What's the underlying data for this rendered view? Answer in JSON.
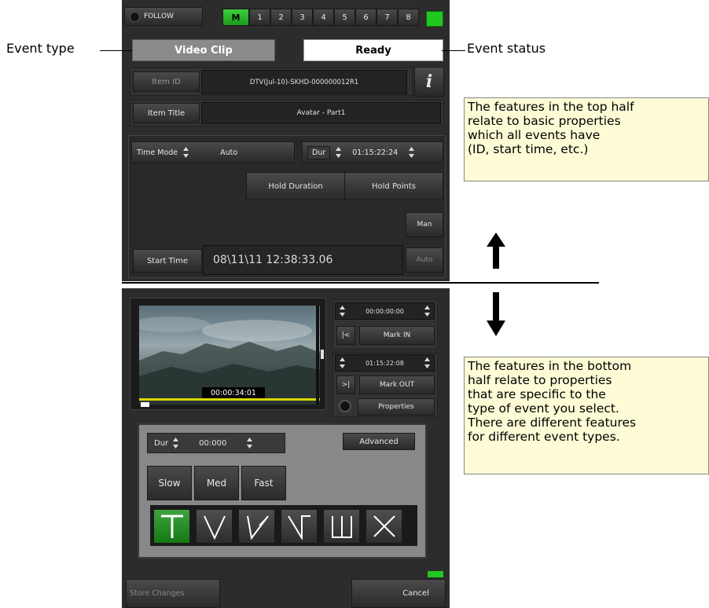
{
  "toolbar": {
    "follow_label": "FOLLOW",
    "channels": [
      "M",
      "1",
      "2",
      "3",
      "4",
      "5",
      "6",
      "7",
      "8"
    ]
  },
  "event": {
    "type_value": "Video Clip",
    "status_value": "Ready",
    "item_id_label": "Item ID",
    "item_id_value": "DTV(Jul-10)-SKHD-000000012R1",
    "info_label": "i",
    "item_title_label": "Item Title",
    "item_title_value": "Avatar - Part1",
    "time_mode_label": "Time Mode",
    "time_mode_value": "Auto",
    "dur_label": "Dur",
    "dur_value": "01:15:22:24",
    "hold_duration_label": "Hold Duration",
    "hold_points_label": "Hold Points",
    "man_label": "Man",
    "start_time_label": "Start Time",
    "start_time_value": "08\\11\\11 12:38:33.06",
    "start_auto_label": "Auto"
  },
  "clip": {
    "timecode_overlay": "00:00:34:01",
    "in_time": "00:00:00:00",
    "go_in_label": "|<",
    "mark_in_label": "Mark IN",
    "out_time": "01:15:22:08",
    "go_out_label": ">|",
    "mark_out_label": "Mark OUT",
    "properties_label": "Properties"
  },
  "transition": {
    "dur_label": "Dur",
    "dur_value": "00:000",
    "advanced_label": "Advanced",
    "speeds": [
      "Slow",
      "Med",
      "Fast"
    ],
    "types_icons": [
      "t-cut-icon",
      "v-fade-icon",
      "v-slant-icon",
      "v-notch-icon",
      "u-dip-icon",
      "x-cross-icon"
    ]
  },
  "footer": {
    "store_label": "Store Changes",
    "cancel_label": "Cancel"
  },
  "annotations": {
    "event_type": "Event type",
    "event_status": "Event status",
    "top_note": "The features in the top half\nrelate to basic properties\nwhich all events have\n(ID, start time, etc.)",
    "bottom_note": "The features in the bottom\nhalf relate to properties\nthat are specific to the\ntype of event you select.\nThere are different features\nfor different event types."
  },
  "colors": {
    "accent_green": "#1fbf1f",
    "panel_bg": "#2c2c2c",
    "note_bg": "#fdfcd6"
  }
}
